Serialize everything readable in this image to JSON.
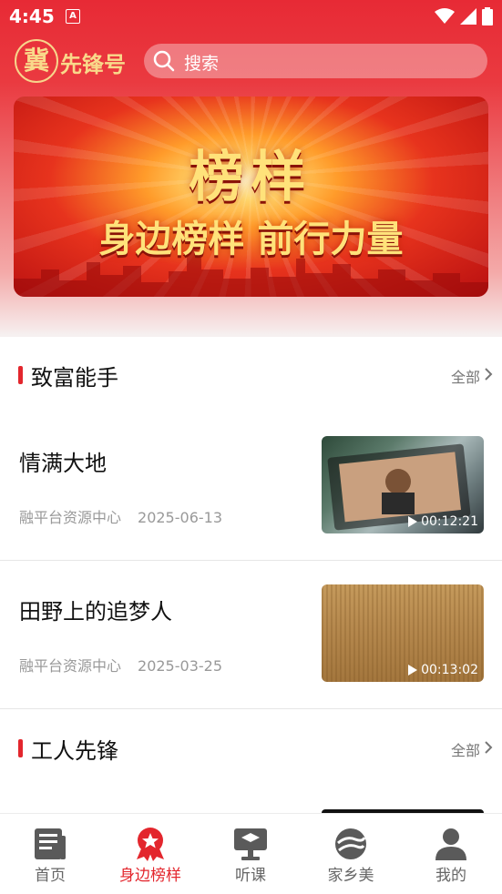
{
  "status": {
    "time": "4:45"
  },
  "header": {
    "logo_char": "冀",
    "logo_text": "先锋号",
    "search_placeholder": "搜索"
  },
  "banner": {
    "title": "榜样",
    "subtitle": "身边榜样 前行力量"
  },
  "sections": [
    {
      "title": "致富能手",
      "more": "全部",
      "items": [
        {
          "title": "情满大地",
          "source": "融平台资源中心",
          "date": "2025-06-13",
          "duration": "00:12:21"
        },
        {
          "title": "田野上的追梦人",
          "source": "融平台资源中心",
          "date": "2025-03-25",
          "duration": "00:13:02"
        }
      ]
    },
    {
      "title": "工人先锋",
      "more": "全部",
      "items": []
    }
  ],
  "nav": [
    {
      "label": "首页",
      "icon": "newspaper-icon",
      "active": false
    },
    {
      "label": "身边榜样",
      "icon": "badge-star-icon",
      "active": true
    },
    {
      "label": "听课",
      "icon": "lecture-screen-icon",
      "active": false
    },
    {
      "label": "家乡美",
      "icon": "landscape-icon",
      "active": false
    },
    {
      "label": "我的",
      "icon": "person-icon",
      "active": false
    }
  ],
  "colors": {
    "accent": "#e3262d",
    "header_red": "#e72a35",
    "gold": "#f9d98a"
  }
}
